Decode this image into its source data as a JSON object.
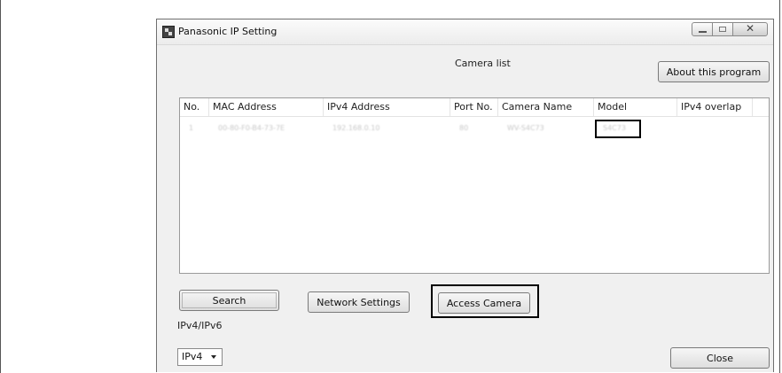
{
  "window": {
    "title": "Panasonic IP Setting",
    "controls": [
      "minimize",
      "maximize",
      "close"
    ]
  },
  "camera_list_label": "Camera list",
  "about_button": "About this program",
  "table": {
    "columns": [
      "No.",
      "MAC Address",
      "IPv4 Address",
      "Port No.",
      "Camera Name",
      "Model",
      "IPv4 overlap"
    ],
    "rows": [
      [
        "1",
        "00-80-F0-B4-73-7E",
        "192.168.0.10",
        "80",
        "WV-S4C73",
        "S4C73",
        ""
      ]
    ]
  },
  "buttons": {
    "search": "Search",
    "network_settings": "Network Settings",
    "access_camera": "Access Camera",
    "close": "Close"
  },
  "ip_version": {
    "label": "IPv4/IPv6",
    "selected": "IPv4"
  }
}
